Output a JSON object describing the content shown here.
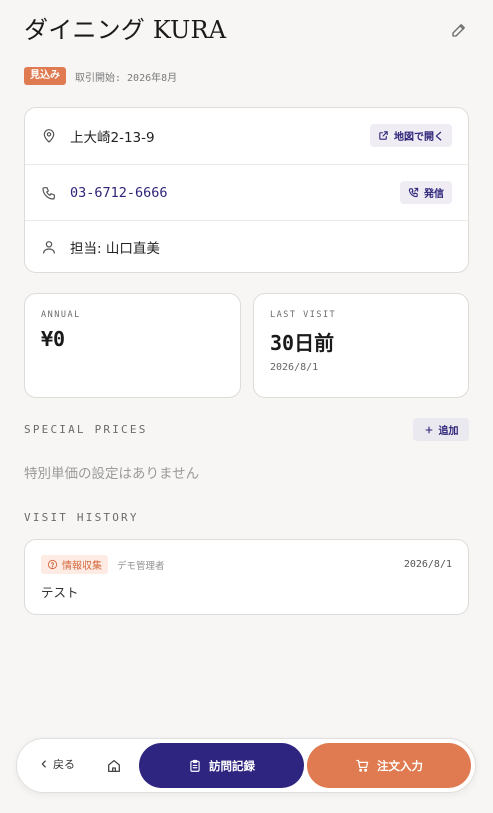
{
  "header": {
    "title": "ダイニング KURA",
    "edit_icon": "pencil-icon"
  },
  "meta": {
    "status_badge": "見込み",
    "since_text": "取引開始: 2026年8月"
  },
  "info": {
    "address": "上大崎2-13-9",
    "map_button": "地図で開く",
    "phone": "03-6712-6666",
    "call_button": "発信",
    "staff": "担当: 山口直美"
  },
  "stats": {
    "annual_label": "ANNUAL",
    "annual_value": "¥0",
    "last_visit_label": "LAST VISIT",
    "last_visit_value": "30日前",
    "last_visit_date": "2026/8/1"
  },
  "special_prices": {
    "title": "SPECIAL PRICES",
    "add_button": "追加",
    "empty_text": "特別単価の設定はありません"
  },
  "visit_history": {
    "title": "VISIT HISTORY",
    "items": [
      {
        "tag": "情報収集",
        "user": "デモ管理者",
        "date": "2026/8/1",
        "note": "テスト"
      }
    ]
  },
  "bottom_nav": {
    "back": "戻る",
    "visit_record": "訪問記録",
    "order_entry": "注文入力"
  },
  "colors": {
    "accent": "#2e2580",
    "brand_orange": "#e07a50",
    "tag_bg": "#fdebe4"
  }
}
